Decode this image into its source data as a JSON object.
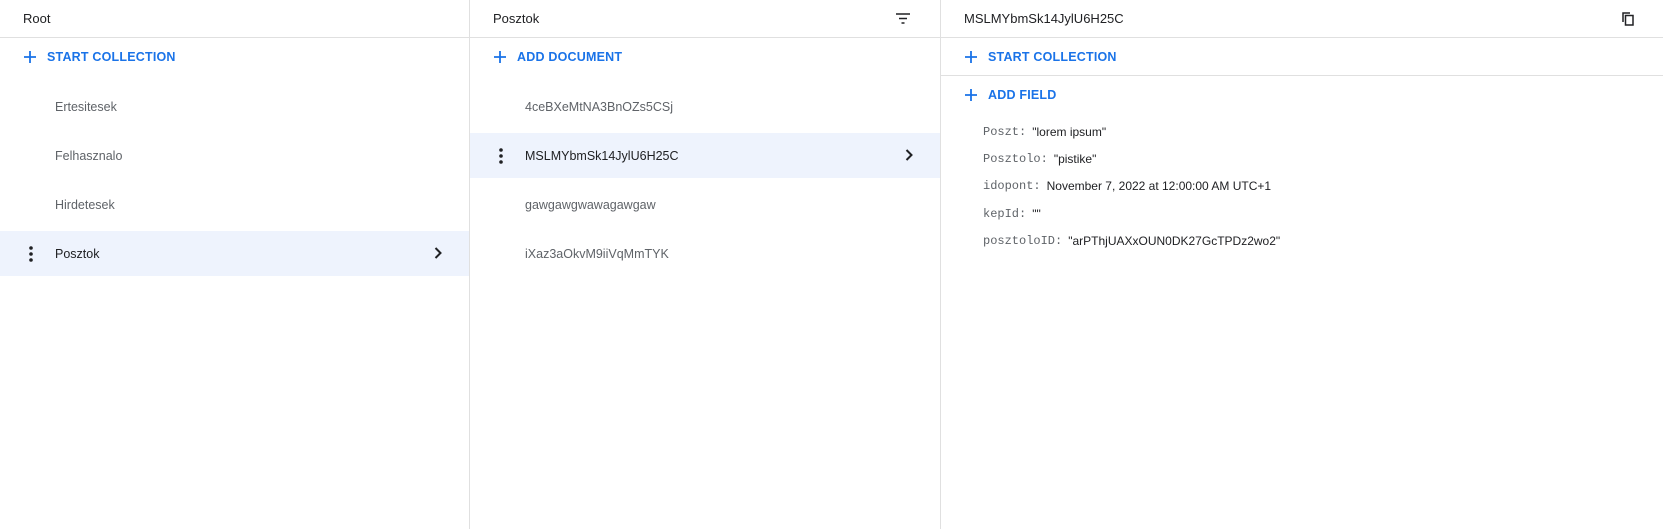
{
  "root_panel": {
    "title": "Root",
    "action_label": "START COLLECTION",
    "items": [
      {
        "label": "Ertesitesek"
      },
      {
        "label": "Felhasznalo"
      },
      {
        "label": "Hirdetesek"
      },
      {
        "label": "Posztok"
      }
    ],
    "selected_index": 3
  },
  "collection_panel": {
    "title": "Posztok",
    "header_icon": "filter-icon",
    "action_label": "ADD DOCUMENT",
    "items": [
      {
        "label": "4ceBXeMtNA3BnOZs5CSj"
      },
      {
        "label": "MSLMYbmSk14JylU6H25C"
      },
      {
        "label": "gawgawgwawagawgaw"
      },
      {
        "label": "iXaz3aOkvM9iiVqMmTYK"
      }
    ],
    "selected_index": 1
  },
  "document_panel": {
    "title": "MSLMYbmSk14JylU6H25C",
    "header_icon": "copy-icon",
    "start_collection_label": "START COLLECTION",
    "add_field_label": "ADD FIELD",
    "fields": [
      {
        "key": "Poszt:",
        "value": "\"lorem ipsum\""
      },
      {
        "key": "Posztolo:",
        "value": "\"pistike\""
      },
      {
        "key": "idopont:",
        "value": "November 7, 2022 at 12:00:00 AM UTC+1"
      },
      {
        "key": "kepId:",
        "value": "\"\""
      },
      {
        "key": "posztoloID:",
        "value": "\"arPThjUAXxOUN0DK27GcTPDz2wo2\""
      }
    ]
  },
  "colors": {
    "accent": "#1a73e8",
    "selected_bg": "#eef3fd",
    "border": "#e0e0e0"
  }
}
